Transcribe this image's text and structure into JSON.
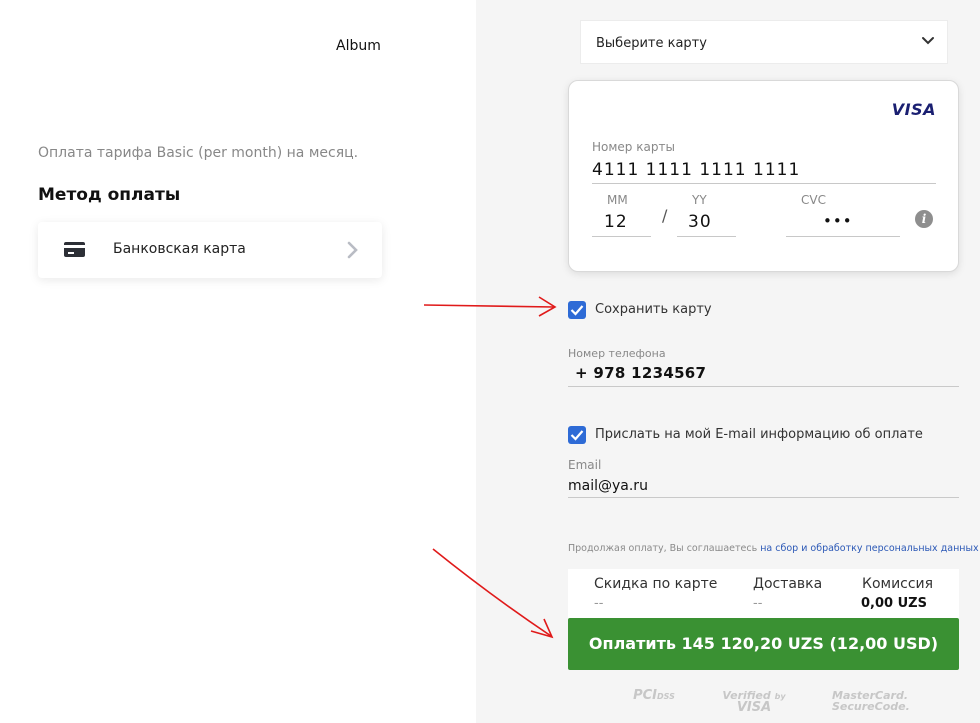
{
  "left": {
    "merchant": "Album",
    "tariff_text": "Оплата тарифа Basic (per month) на месяц.",
    "method_title": "Метод оплаты",
    "method_option": "Банковская карта"
  },
  "card_selector": {
    "placeholder": "Выберите карту"
  },
  "card_form": {
    "brand": "VISA",
    "number_label": "Номер карты",
    "number_value": "4111 1111 1111 1111",
    "mm_label": "MM",
    "mm_value": "12",
    "yy_label": "YY",
    "yy_value": "30",
    "cvc_label": "CVC",
    "cvc_value": "•••",
    "separator": "/",
    "info_glyph": "i"
  },
  "save_card": {
    "checked": true,
    "label": "Сохранить карту"
  },
  "phone": {
    "label": "Номер телефона",
    "value": "+ 978 1234567"
  },
  "email_receipt": {
    "checked": true,
    "label": "Прислать на мой E-mail информацию об оплате"
  },
  "email": {
    "label": "Email",
    "value": "mail@ya.ru"
  },
  "consent": {
    "prefix": "Продолжая оплату, Вы соглашаетесь ",
    "link": "на сбор и обработку персональных данных"
  },
  "summary": {
    "discount_label": "Скидка по карте",
    "discount_value": "--",
    "delivery_label": "Доставка",
    "delivery_value": "--",
    "commission_label": "Комиссия",
    "commission_value": "0,00 UZS"
  },
  "pay_button": "Оплатить 145 120,20 UZS (12,00 USD)",
  "badges": {
    "pci": "PCI",
    "pci_dss": "DSS",
    "verified_line1": "Verified",
    "verified_by": "by",
    "verified_line2": "VISA",
    "mastercard_line1": "MasterCard.",
    "mastercard_line2": "SecureCode."
  },
  "colors": {
    "accent_green": "#3a9133",
    "checkbox_blue": "#2e6bd6",
    "link_blue": "#2b58b6",
    "annotation_red": "#e01a1a",
    "visa_blue": "#1a1f71"
  }
}
